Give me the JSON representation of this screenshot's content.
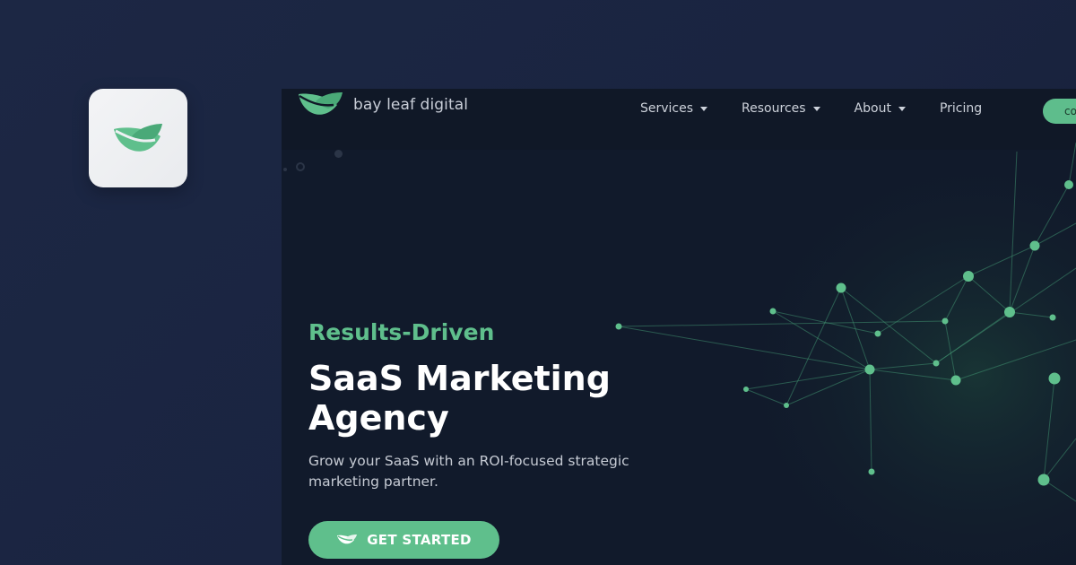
{
  "brand": {
    "name": "bay leaf digital",
    "logo_icon": "leaf-icon"
  },
  "nav": {
    "items": [
      {
        "label": "Services",
        "has_dropdown": true
      },
      {
        "label": "Resources",
        "has_dropdown": true
      },
      {
        "label": "About",
        "has_dropdown": true
      },
      {
        "label": "Pricing",
        "has_dropdown": false
      }
    ],
    "cta_label": "co"
  },
  "hero": {
    "kicker": "Results-Driven",
    "headline_line1": "SaaS Marketing",
    "headline_line2": "Agency",
    "subtext_line1": "Grow your SaaS with an ROI-focused strategic",
    "subtext_line2": "marketing partner.",
    "cta_label": "GET STARTED",
    "cta_icon": "leaf-icon"
  },
  "colors": {
    "page_bg": "#1c2744",
    "site_bg": "#111a2b",
    "accent_green": "#5fbf8c",
    "text_light": "#c6cbd4",
    "white": "#ffffff"
  }
}
